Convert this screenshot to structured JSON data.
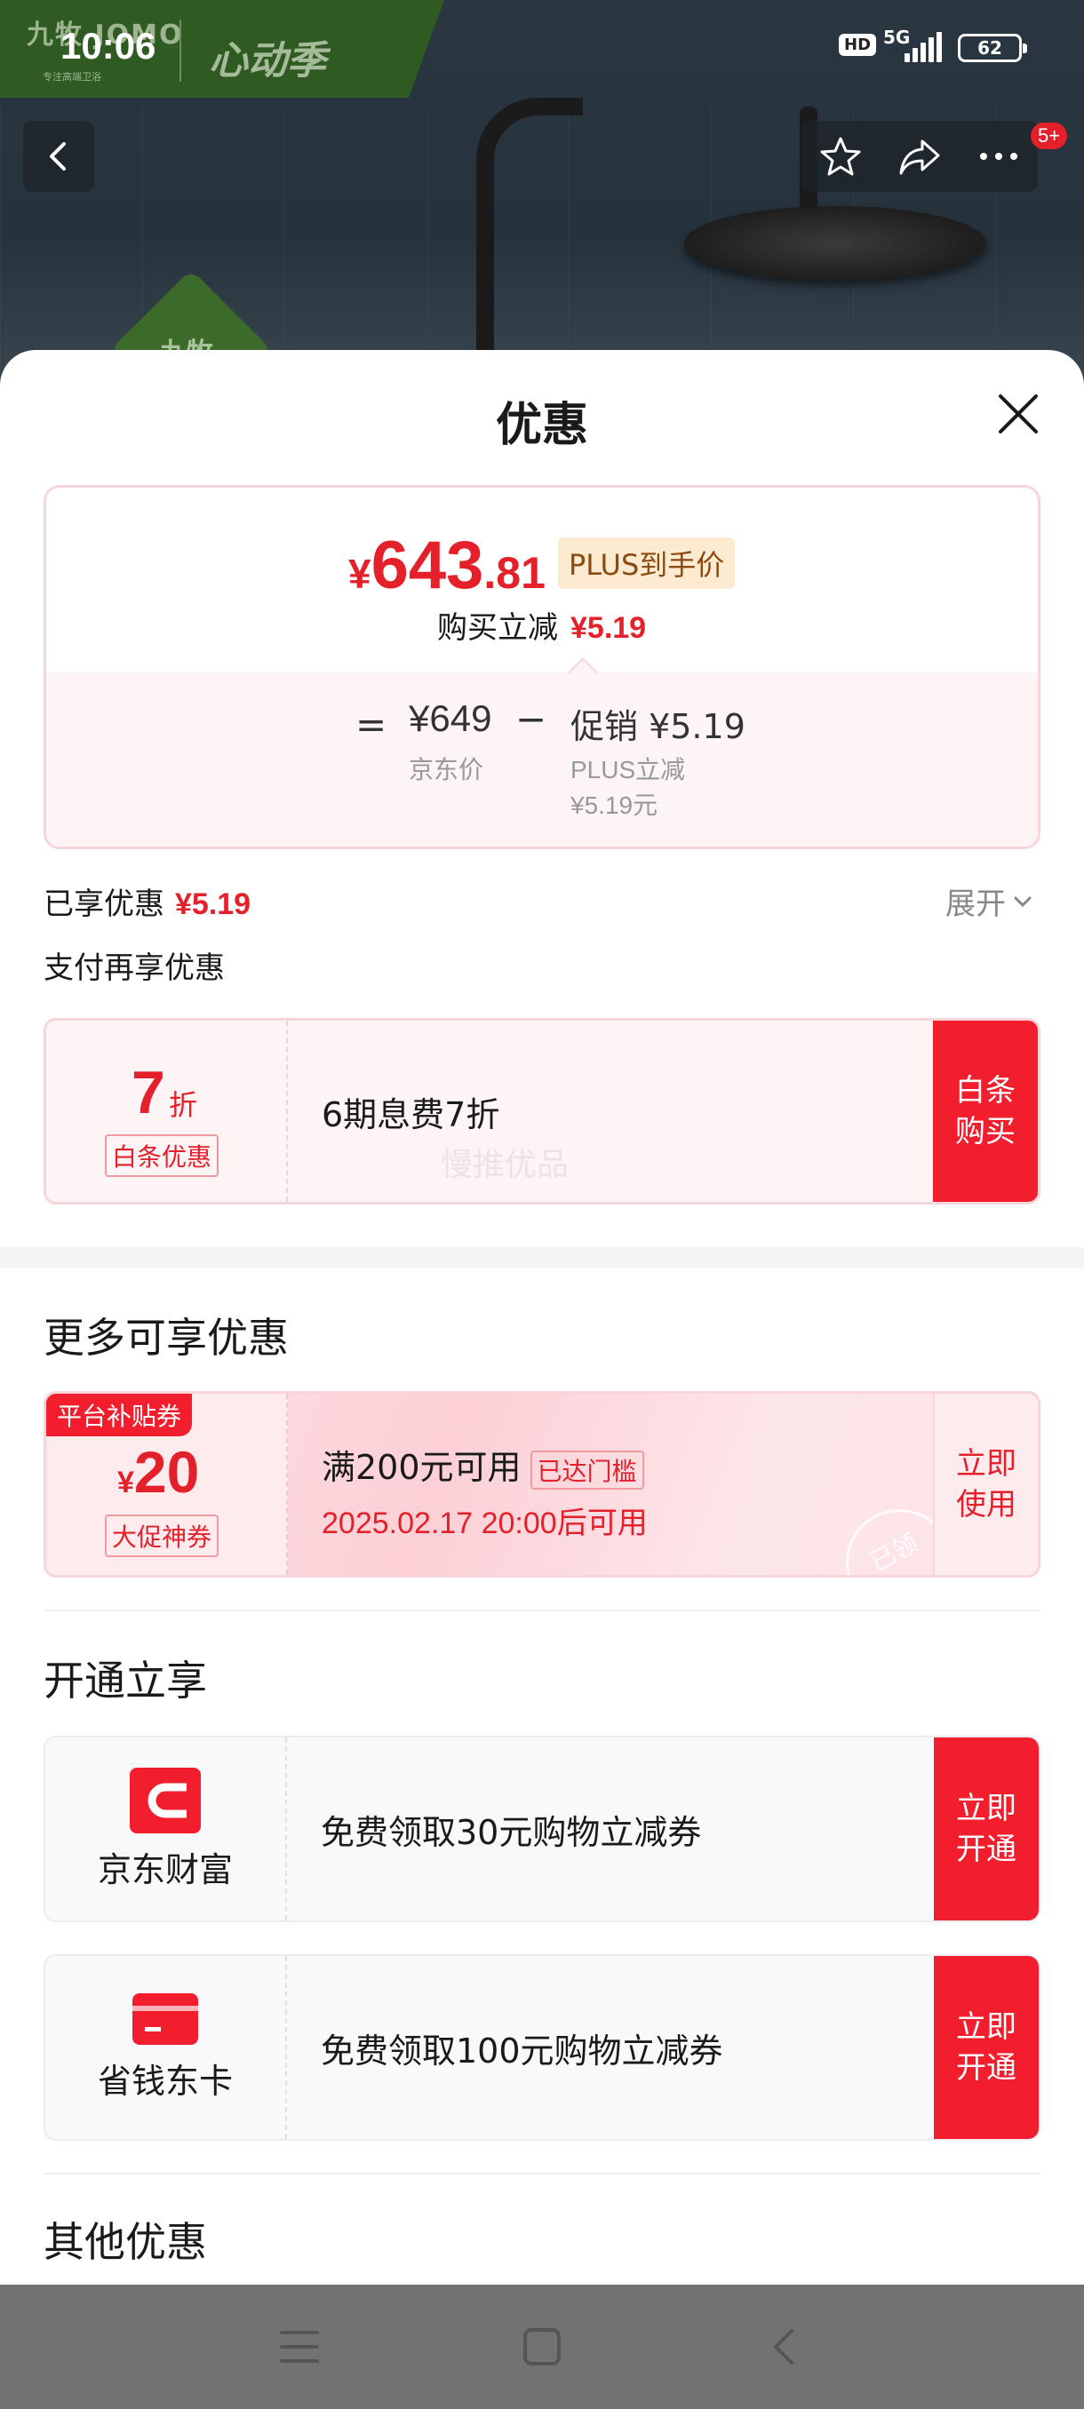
{
  "status": {
    "time": "10:06",
    "hd": "HD",
    "net": "5G",
    "battery": "62"
  },
  "brand": {
    "logo": "九牧 JOMO",
    "logo_sub": "专注高端卫浴",
    "campaign": "心动季",
    "badge": "九牧"
  },
  "nav": {
    "more_badge": "5+"
  },
  "sheet": {
    "title": "优惠",
    "price": {
      "symbol": "¥",
      "integer": "643",
      "decimal": ".81",
      "plus_tag": "PLUS到手价",
      "instant_cut_label": "购买立减",
      "instant_cut_value": "¥5.19"
    },
    "breakdown": {
      "eq": "=",
      "jd_price": "¥649",
      "jd_price_label": "京东价",
      "minus": "−",
      "promo": "促销 ¥5.19",
      "promo_sub1": "PLUS立减",
      "promo_sub2": "¥5.19元"
    },
    "enjoyed_label": "已享优惠",
    "enjoyed_value": "¥5.19",
    "expand_label": "展开",
    "pay_more_label": "支付再享优惠",
    "baitiao": {
      "big": "7",
      "unit": "折",
      "tag": "白条优惠",
      "text": "6期息费7折",
      "button": "白条购买"
    },
    "watermark": "慢推优品",
    "more_section_title": "更多可享优惠",
    "coupon": {
      "platform_tag": "平台补贴券",
      "symbol": "¥",
      "amount": "20",
      "tag": "大促神券",
      "condition": "满200元可用",
      "reached": "已达门槛",
      "time": "2025.02.17 20:00后可用",
      "button": "立即使用",
      "stamp": "已领"
    },
    "open_section_title": "开通立享",
    "open_cards": [
      {
        "name": "京东财富",
        "text": "免费领取30元购物立减券",
        "button": "立即开通"
      },
      {
        "name": "省钱东卡",
        "text": "免费领取100元购物立减券",
        "button": "立即开通"
      }
    ],
    "other_section_title": "其他优惠"
  },
  "colors": {
    "accent": "#e4202b",
    "button_red": "#f21d2d",
    "plus_gold": "#8a4a12"
  }
}
